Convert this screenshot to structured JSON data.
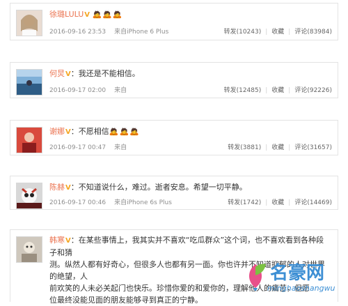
{
  "posts": [
    {
      "name": "徐璐LULU",
      "vbadge": "V",
      "text": "",
      "emoji": "🙇🙇🙇",
      "date": "2016-09-16 23:53",
      "source": "来自iPhone 6 Plus",
      "repost": "转发(10243)",
      "fav": "收藏",
      "comment": "评论(83984)"
    },
    {
      "name": "何炅",
      "vbadge": "V",
      "text": "：我还是不能相信。",
      "emoji": "",
      "date": "2016-09-17 02:00",
      "source": "来自",
      "repost": "转发(12485)",
      "fav": "收藏",
      "comment": "评论(92226)"
    },
    {
      "name": "谢娜",
      "vbadge": "V",
      "text": "：不愿相信",
      "emoji": "🙇🙇🙇",
      "date": "2016-09-17 00:47",
      "source": "来自",
      "repost": "转发(3881)",
      "fav": "收藏",
      "comment": "评论(31657)"
    },
    {
      "name": "陈赫",
      "vbadge": "V",
      "text": "：不知道说什么，难过。逝者安息。希望一切平静。",
      "emoji": "",
      "date": "2016-09-17 00:46",
      "source": "来自iPhone 6s Plus",
      "repost": "转发(1742)",
      "fav": "收藏",
      "comment": "评论(14469)"
    },
    {
      "name": "韩寒",
      "vbadge": "V",
      "lines": [
        "：在某些事情上，我其实并不喜欢“吃瓜群众”这个词，也不喜欢看到各种段子和猜",
        "测。纵然人都有好奇心，但很多人也都有另一面。你也许并不知道抑郁的人对世界的绝望，人",
        "前欢笑的人未必关起门也快乐。珍惜你爱的和爱你的，理解他人的痛苦，但愿",
        "位最终没能见面的朋友能够寻到真正的宁静。"
      ]
    }
  ],
  "watermark": {
    "name": "名豪网",
    "url": "minghaoshangwu"
  },
  "colors": {
    "name": "#eb7350",
    "vbadge": "#f5a623",
    "meta": "#8e8e8e",
    "border": "#e3e3e3"
  }
}
